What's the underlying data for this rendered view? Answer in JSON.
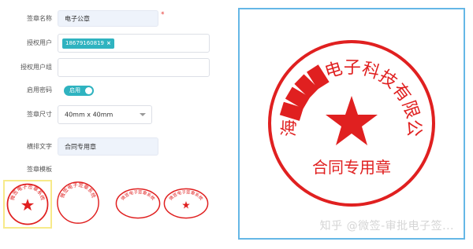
{
  "form": {
    "seal_name": {
      "label": "签章名称",
      "value": "电子公章",
      "required_mark": "*"
    },
    "authorized_users": {
      "label": "授权用户",
      "tags": [
        "18679160819"
      ],
      "remove_glyph": "×"
    },
    "authorized_groups": {
      "label": "授权用户组",
      "value": ""
    },
    "enable_password": {
      "label": "启用密码",
      "toggle_text": "启用",
      "enabled": true
    },
    "seal_size": {
      "label": "签章尺寸",
      "value": "40mm x 40mm"
    },
    "horizontal_text": {
      "label": "横排文字",
      "value": "合同专用章"
    },
    "template": {
      "label": "签章模板"
    }
  },
  "templates": [
    {
      "arc_text": "微签电子签章系统",
      "selected": true
    },
    {
      "arc_text": "微签电子签章系统",
      "selected": false
    },
    {
      "arc_text": "微签电子签章系统",
      "selected": false
    },
    {
      "arc_text": "微签电子签章系统",
      "selected": false
    }
  ],
  "preview": {
    "arc_text": "上海████电子科技有限公司",
    "horizontal_text": "合同专用章"
  },
  "watermark": "知乎 @微签-审批电子签...",
  "colors": {
    "accent": "#2fb3c0",
    "seal_red": "#e02020",
    "preview_border": "#65b7e6",
    "selected_template_border": "#f7ea8a",
    "filled_input_bg": "#eef3fb"
  }
}
